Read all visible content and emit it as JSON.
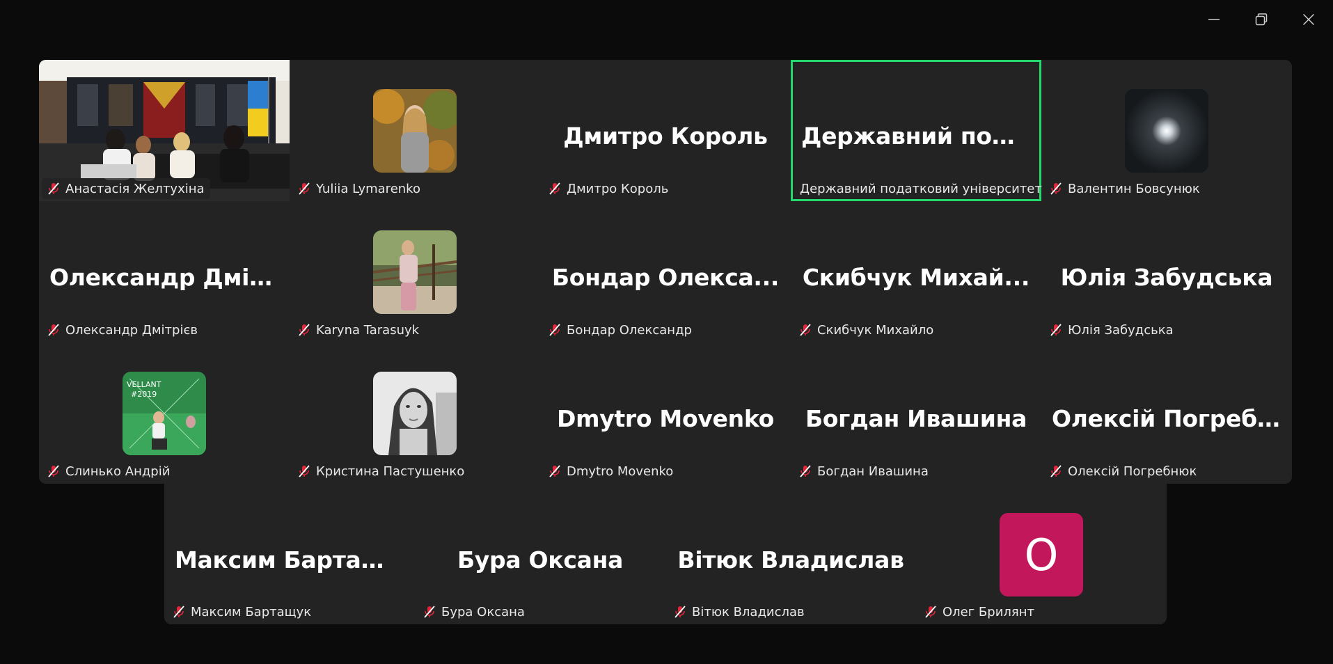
{
  "window": {
    "controls": [
      "minimize-icon",
      "restore-icon",
      "close-icon"
    ]
  },
  "colors": {
    "background": "#0b0b0b",
    "tile_bg": "#232323",
    "active_speaker_border": "#23d96b",
    "muted_mic": "#e0263b",
    "letter_avatar_bg": "#c2185b"
  },
  "participants": [
    {
      "name": "Анастасія Желтухіна",
      "muted": true,
      "type": "video"
    },
    {
      "name": "Yuliia Lymarenko",
      "muted": true,
      "type": "photo"
    },
    {
      "name": "Дмитро Король",
      "display": "Дмитро Король",
      "muted": true,
      "type": "name"
    },
    {
      "name": "Державний податковий університет",
      "display": "Державний под...",
      "muted": false,
      "type": "name",
      "active": true
    },
    {
      "name": "Валентин Бовсунюк",
      "muted": true,
      "type": "photo"
    },
    {
      "name": "Олександр Дмітрієв",
      "display": "Олександр Дміт...",
      "muted": true,
      "type": "name"
    },
    {
      "name": "Karyna Tarasuyk",
      "muted": true,
      "type": "photo"
    },
    {
      "name": "Бондар Олександр",
      "display": "Бондар Олекса...",
      "muted": true,
      "type": "name"
    },
    {
      "name": "Скибчук Михайло",
      "display": "Скибчук Михай...",
      "muted": true,
      "type": "name"
    },
    {
      "name": "Юлія Забудська",
      "display": "Юлія Забудська",
      "muted": true,
      "type": "name"
    },
    {
      "name": "Слинько Андрій",
      "muted": true,
      "type": "photo"
    },
    {
      "name": "Кристина Пастушенко",
      "muted": true,
      "type": "photo"
    },
    {
      "name": "Dmytro Movenko",
      "display": "Dmytro Movenko",
      "muted": true,
      "type": "name"
    },
    {
      "name": "Богдан Ивашина",
      "display": "Богдан Ивашина",
      "muted": true,
      "type": "name"
    },
    {
      "name": "Олексій Погребнюк",
      "display": "Олексій Погреб...",
      "muted": true,
      "type": "name"
    },
    {
      "name": "Максим Бартащук",
      "display": "Максим Бартащ...",
      "muted": true,
      "type": "name"
    },
    {
      "name": "Бура Оксана",
      "display": "Бура Оксана",
      "muted": true,
      "type": "name"
    },
    {
      "name": "Вітюк Владислав",
      "display": "Вітюк Владислав",
      "muted": true,
      "type": "name"
    },
    {
      "name": "Олег Брилянт",
      "letter": "O",
      "muted": true,
      "type": "letter"
    }
  ]
}
